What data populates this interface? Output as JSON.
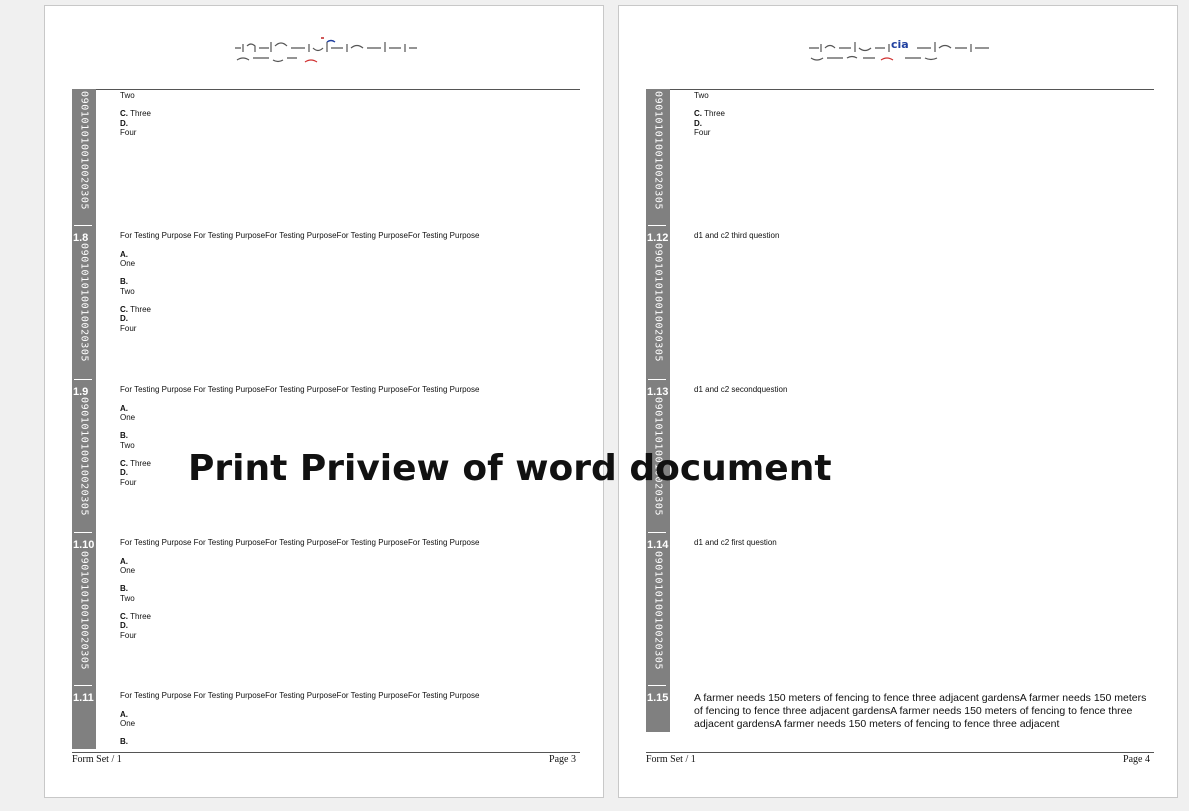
{
  "watermark": "Print Priview of word document",
  "code": "090101010010020305",
  "colors": {
    "sidebar": "#808080",
    "page": "#ffffff",
    "background": "#f0f0f0"
  },
  "pages": [
    {
      "footer_left": "Form Set / 1",
      "footer_right": "Page 3",
      "continuation": {
        "b_text": "Two",
        "c": "Three",
        "d": "Four"
      },
      "questions": [
        {
          "number": "1.8",
          "text": "For Testing Purpose For Testing PurposeFor Testing PurposeFor Testing PurposeFor Testing Purpose",
          "options": {
            "a": "One",
            "b": "Two",
            "c": "Three",
            "d": "Four"
          }
        },
        {
          "number": "1.9",
          "text": "For Testing Purpose For Testing PurposeFor Testing PurposeFor Testing PurposeFor Testing Purpose",
          "options": {
            "a": "One",
            "b": "Two",
            "c": "Three",
            "d": "Four"
          }
        },
        {
          "number": "1.10",
          "text": "For Testing Purpose For Testing PurposeFor Testing PurposeFor Testing PurposeFor Testing Purpose",
          "options": {
            "a": "One",
            "b": "Two",
            "c": "Three",
            "d": "Four"
          }
        },
        {
          "number": "1.11",
          "text": "For Testing Purpose For Testing PurposeFor Testing PurposeFor Testing PurposeFor Testing Purpose",
          "options": {
            "a": "One"
          }
        }
      ]
    },
    {
      "footer_left": "Form Set / 1",
      "footer_right": "Page 4",
      "continuation": {
        "b_text": "Two",
        "c": "Three",
        "d": "Four"
      },
      "questions": [
        {
          "number": "1.12",
          "text": "d1 and c2  third question"
        },
        {
          "number": "1.13",
          "text": "d1 and c2  secondquestion"
        },
        {
          "number": "1.14",
          "text": "d1 and c2  first question"
        },
        {
          "number": "1.15",
          "text": "A farmer needs 150 meters of fencing to fence three adjacent gardensA farmer needs 150 meters of fencing to fence three adjacent gardensA farmer needs 150 meters of fencing to fence three adjacent gardensA farmer needs 150 meters of fencing to fence three adjacent"
        }
      ]
    }
  ],
  "option_letters": {
    "a": "A.",
    "b": "B.",
    "c": "C.",
    "d": "D."
  }
}
